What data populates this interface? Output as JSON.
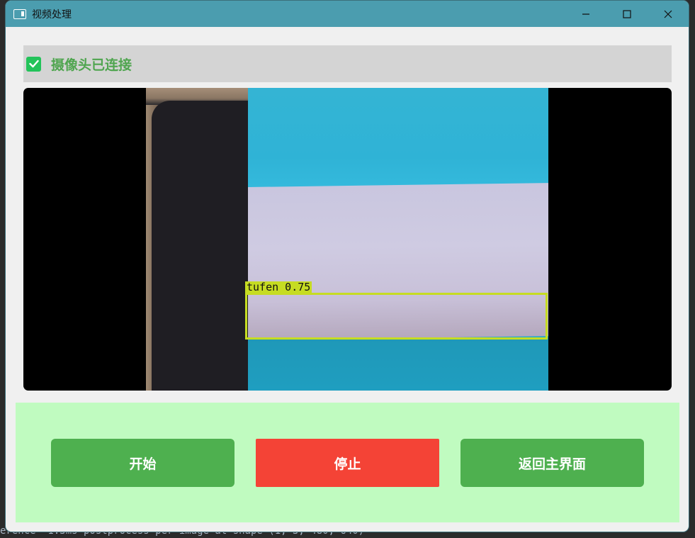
{
  "window": {
    "title": "视频处理"
  },
  "status": {
    "checked": true,
    "text": "摄像头已连接"
  },
  "video": {
    "detection_label": "tufen 0.75"
  },
  "controls": {
    "start_label": "开始",
    "stop_label": "停止",
    "home_label": "返回主界面"
  },
  "background": {
    "terminal_line": "erence  1.3ms postprocess per image at shape (1, 3, 480, 640)"
  },
  "colors": {
    "titlebar": "#4b9daf",
    "status_text": "#4fa54f",
    "checkbox": "#23c35a",
    "panel_bg": "#c0fbc0",
    "start_button": "#4eb04f",
    "stop_button": "#f44336",
    "home_button": "#4eb04f",
    "bbox": "#c6dc22"
  },
  "icons": {
    "app": "window-icon",
    "minimize": "minimize-icon",
    "maximize": "maximize-icon",
    "close": "close-icon",
    "check": "checkmark-icon"
  }
}
